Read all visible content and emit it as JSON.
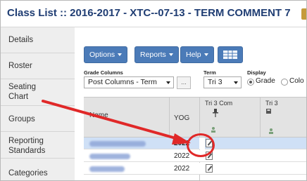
{
  "window": {
    "title": "Class List :: 2016-2017 - XTC--07-13 - TERM COMMENT 7"
  },
  "sidebar": {
    "items": [
      {
        "label": "Details"
      },
      {
        "label": "Roster"
      },
      {
        "label": "Seating\nChart"
      },
      {
        "label": "Groups"
      },
      {
        "label": "Reporting\nStandards"
      },
      {
        "label": "Categories"
      }
    ]
  },
  "toolbar": {
    "options_label": "Options",
    "reports_label": "Reports",
    "help_label": "Help",
    "grid_icon": "grid-icon"
  },
  "filters": {
    "grade_columns_label": "Grade Columns",
    "grade_columns_value": "Post Columns - Term",
    "dots_label": "...",
    "term_label": "Term",
    "term_value": "Tri 3",
    "display_label": "Display",
    "display_options": [
      "Grade",
      "Colo"
    ]
  },
  "table": {
    "headers": {
      "name": "Name",
      "yog": "YOG",
      "col1": "Tri 3 Com",
      "col2": "Tri 3"
    },
    "rows": [
      {
        "yog": "2022",
        "selected": true
      },
      {
        "yog": "2022",
        "selected": false
      },
      {
        "yog": "2022",
        "selected": false
      }
    ]
  },
  "colors": {
    "title": "#1f3d73",
    "button": "#4b7bb8",
    "selected_row": "#cfe0f6",
    "annotation": "#e02828"
  }
}
